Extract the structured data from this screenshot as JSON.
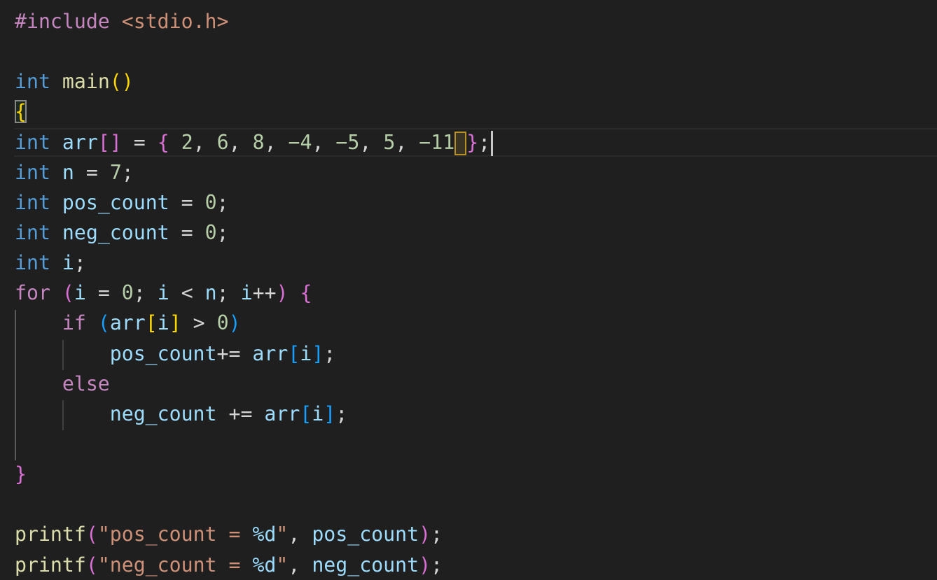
{
  "editor": {
    "language": "C",
    "lines": {
      "include_directive": "#include",
      "include_header": "<stdio.h>",
      "main_type": "int",
      "main_name": "main",
      "open_brace": "{",
      "arr_type": "int",
      "arr_name": "arr",
      "arr_values": [
        "2",
        "6",
        "8",
        "-4",
        "-5",
        "5",
        "-11"
      ],
      "n_type": "int",
      "n_name": "n",
      "n_value": "7",
      "pos_type": "int",
      "pos_name": "pos_count",
      "pos_value": "0",
      "neg_type": "int",
      "neg_name": "neg_count",
      "neg_value": "0",
      "i_type": "int",
      "i_name": "i",
      "for_kw": "for",
      "for_init": "0",
      "if_kw": "if",
      "if_cmp": "0",
      "else_kw": "else",
      "pos_stmt_var": "pos_count",
      "neg_stmt_var": "neg_count",
      "close_brace": "}",
      "printf1_fn": "printf",
      "printf1_str": "\"pos_count = ",
      "printf1_fmt": "%d",
      "printf1_arg": "pos_count",
      "printf2_fn": "printf",
      "printf2_str": "\"neg_count = ",
      "printf2_fmt": "%d",
      "printf2_arg": "neg_count"
    }
  },
  "theme": {
    "background": "#1f1f1f",
    "keyword_type": "#569cd6",
    "keyword_control": "#c586c0",
    "function": "#dcdcaa",
    "variable": "#9cdcfe",
    "number": "#b5cea8",
    "string": "#ce9178",
    "bracket_level1": "#ffd700",
    "bracket_level2": "#da70d6",
    "bracket_level3": "#179fff"
  }
}
